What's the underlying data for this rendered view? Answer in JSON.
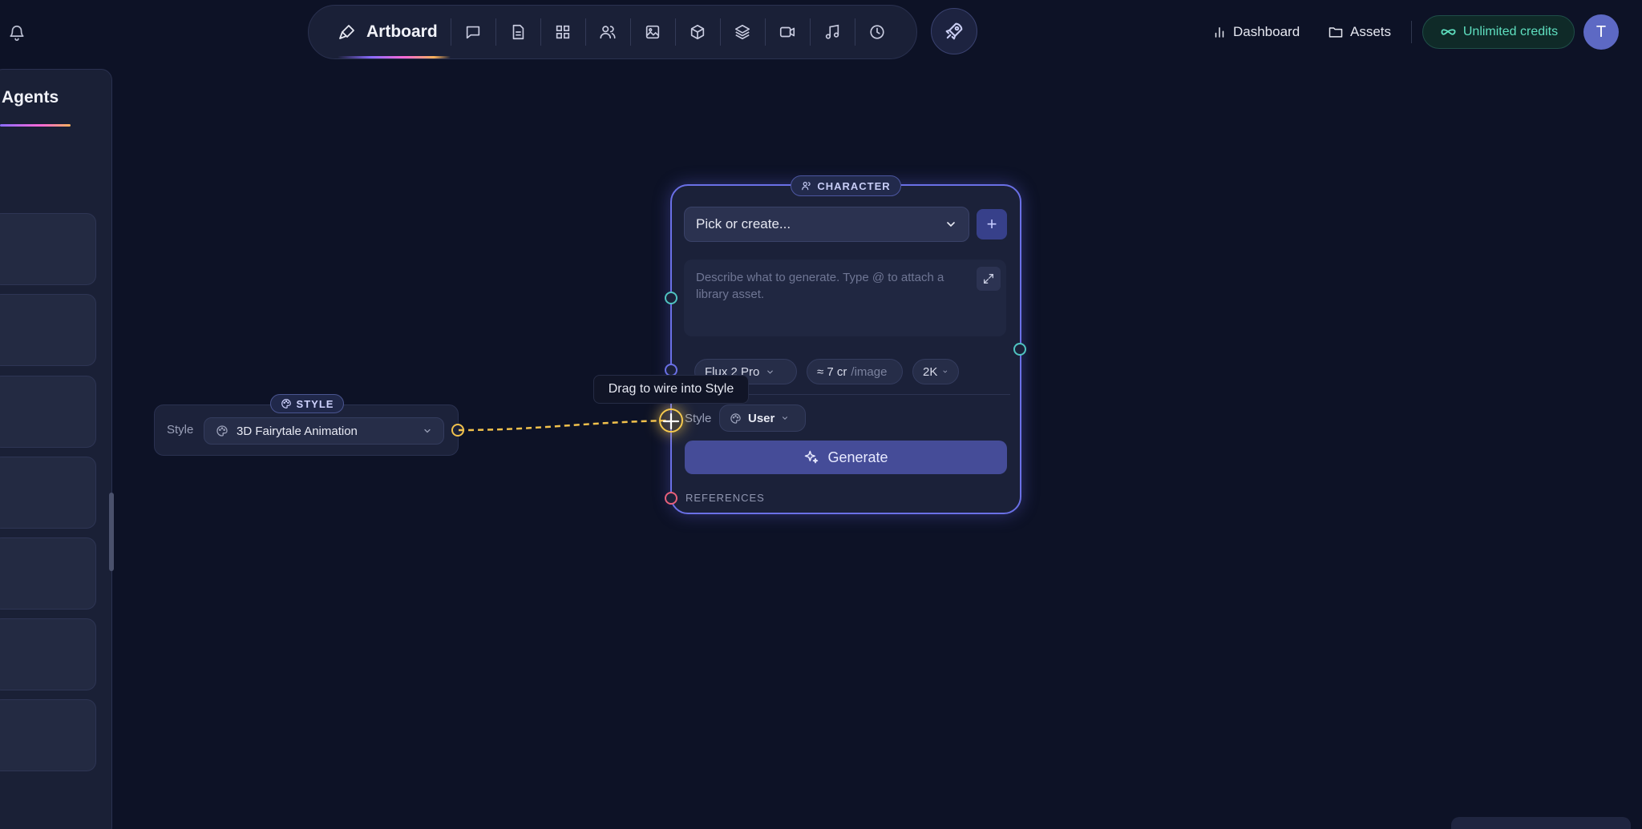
{
  "topbar": {
    "artboard_label": "Artboard",
    "tools": [
      "chat-icon",
      "document-icon",
      "grid-icon",
      "users-icon",
      "image-icon",
      "cube-icon",
      "layers-icon",
      "video-icon",
      "music-icon",
      "clock-icon"
    ],
    "dashboard_label": "Dashboard",
    "assets_label": "Assets",
    "credits_label": "Unlimited credits",
    "avatar_initial": "T"
  },
  "sidebar": {
    "title": "Agents"
  },
  "style_node": {
    "badge": "STYLE",
    "label": "Style",
    "selected": "3D Fairytale Animation"
  },
  "tooltip": "Drag to wire into Style",
  "character_node": {
    "badge": "CHARACTER",
    "pick_placeholder": "Pick or create...",
    "add_label": "+",
    "prompt_placeholder": "Describe what to generate. Type @ to attach a library asset.",
    "model": "Flux 2 Pro",
    "cost": "≈ 7 cr",
    "cost_unit": "/image",
    "resolution": "2K",
    "style_label": "Style",
    "style_value": "User",
    "generate_label": "Generate",
    "references_label": "REFERENCES"
  },
  "colors": {
    "background": "#0d1226",
    "accent": "#6a70e6",
    "wire": "#f1c14c",
    "credits": "#5fe0c0",
    "port_teal": "#4fc3c0",
    "port_pink": "#e8607a"
  }
}
